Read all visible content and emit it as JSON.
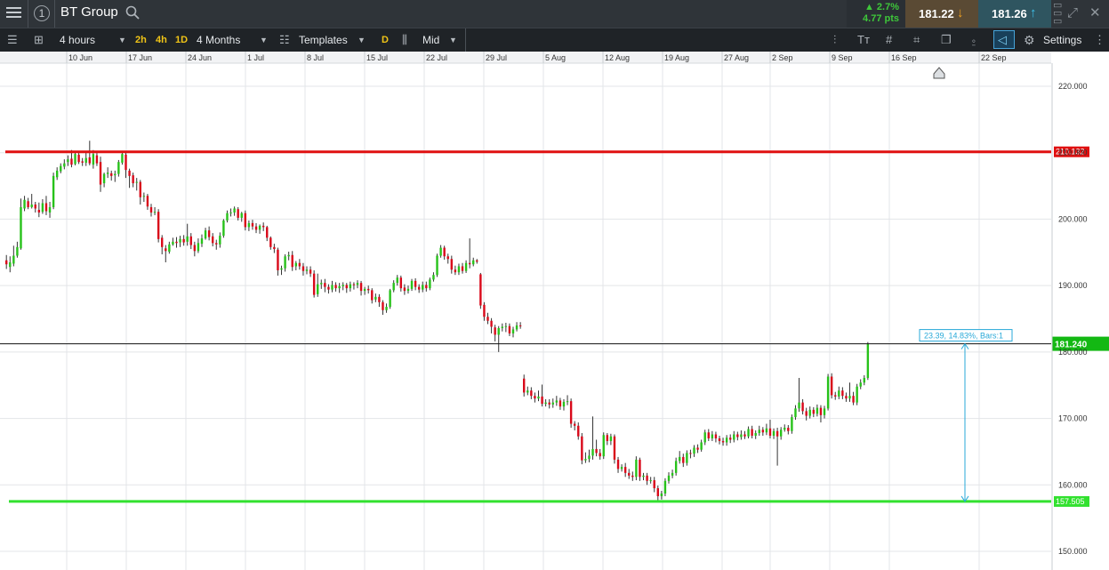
{
  "header": {
    "symbol": "BT Group",
    "change_pct": "▲ 2.7%",
    "change_pts": "4.77 pts",
    "sell_price": "181.22",
    "buy_price": "181.26"
  },
  "toolbar": {
    "interval": "4 hours",
    "quick_intervals": [
      "2h",
      "4h",
      "1D"
    ],
    "range": "4 Months",
    "templates": "Templates",
    "draw_mode": "D",
    "price_type": "Mid",
    "settings": "Settings"
  },
  "colors": {
    "up": "#27c21a",
    "down": "#d9091a",
    "resistance": "#e01010",
    "support": "#32e12f",
    "measure": "#29a9d8",
    "grid": "#e3e5e8"
  },
  "chart_data": {
    "type": "candlestick",
    "x_ticks": [
      "10 Jun",
      "17 Jun",
      "24 Jun",
      "1 Jul",
      "8 Jul",
      "15 Jul",
      "22 Jul",
      "29 Jul",
      "5 Aug",
      "12 Aug",
      "19 Aug",
      "27 Aug",
      "2 Sep",
      "9 Sep",
      "16 Sep",
      "22 Sep"
    ],
    "y_ticks": [
      "220.000",
      "210.000",
      "200.000",
      "190.000",
      "180.000",
      "170.000",
      "160.000",
      "150.000"
    ],
    "y_range": [
      148,
      223
    ],
    "resistance_level": 210.132,
    "resistance_label": "210.132",
    "support_level": 157.505,
    "support_label": "157.505",
    "last_price": 181.24,
    "last_price_label": "181.240",
    "measure_label": "23.39, 14.83%, Bars:1",
    "candles": [
      [
        193.8,
        193.2,
        194.6,
        192.5
      ],
      [
        192.8,
        193.5,
        194.4,
        192.0
      ],
      [
        193.3,
        194.5,
        196.0,
        192.9
      ],
      [
        194.5,
        195.8,
        196.6,
        194.2
      ],
      [
        195.6,
        201.8,
        203.1,
        195.4
      ],
      [
        201.6,
        202.9,
        203.5,
        201.2
      ],
      [
        202.7,
        201.8,
        203.2,
        201.5
      ],
      [
        201.8,
        202.2,
        203.8,
        201.6
      ],
      [
        202.2,
        201.6,
        202.6,
        201.0
      ],
      [
        201.4,
        201.0,
        202.5,
        200.3
      ],
      [
        201.1,
        202.4,
        203.0,
        200.8
      ],
      [
        202.4,
        201.2,
        203.5,
        200.6
      ],
      [
        201.0,
        201.8,
        202.6,
        200.2
      ],
      [
        201.8,
        206.5,
        207.0,
        201.5
      ],
      [
        206.3,
        207.3,
        207.8,
        205.9
      ],
      [
        207.2,
        208.0,
        208.4,
        206.9
      ],
      [
        207.9,
        208.4,
        209.0,
        207.5
      ],
      [
        208.6,
        209.0,
        209.6,
        208.0
      ],
      [
        209.1,
        208.2,
        210.4,
        207.8
      ],
      [
        208.3,
        209.8,
        210.3,
        208.1
      ],
      [
        209.7,
        208.6,
        210.1,
        208.3
      ],
      [
        208.7,
        208.5,
        209.2,
        208.0
      ],
      [
        208.5,
        209.2,
        210.2,
        208.0
      ],
      [
        209.3,
        208.4,
        211.8,
        208.1
      ],
      [
        208.2,
        209.8,
        210.4,
        207.6
      ],
      [
        209.6,
        208.4,
        210.0,
        208.0
      ],
      [
        208.6,
        205.2,
        209.4,
        204.1
      ],
      [
        205.4,
        206.8,
        207.0,
        204.8
      ],
      [
        206.8,
        207.0,
        207.8,
        206.2
      ],
      [
        206.9,
        206.5,
        207.3,
        205.8
      ],
      [
        206.6,
        206.8,
        207.3,
        205.6
      ],
      [
        206.8,
        208.6,
        208.9,
        206.4
      ],
      [
        208.5,
        209.8,
        210.3,
        208.2
      ],
      [
        209.7,
        207.4,
        210.0,
        206.2
      ],
      [
        207.3,
        206.5,
        207.6,
        204.7
      ],
      [
        206.6,
        205.4,
        207.0,
        204.8
      ],
      [
        205.5,
        205.6,
        206.2,
        204.3
      ],
      [
        205.6,
        203.3,
        205.9,
        202.2
      ],
      [
        203.4,
        203.5,
        204.0,
        202.6
      ],
      [
        203.5,
        201.9,
        203.8,
        201.4
      ],
      [
        201.8,
        201.0,
        202.3,
        200.4
      ],
      [
        201.0,
        201.1,
        201.8,
        200.6
      ],
      [
        201.1,
        197.0,
        201.5,
        196.5
      ],
      [
        197.2,
        195.8,
        197.6,
        194.7
      ],
      [
        195.6,
        195.2,
        196.1,
        193.5
      ],
      [
        195.1,
        196.2,
        196.6,
        194.8
      ],
      [
        196.2,
        196.6,
        197.2,
        196.0
      ],
      [
        196.6,
        196.4,
        197.3,
        195.7
      ],
      [
        196.5,
        197.0,
        197.5,
        195.8
      ],
      [
        197.0,
        196.5,
        197.6,
        196.0
      ],
      [
        196.6,
        197.4,
        199.3,
        196.0
      ],
      [
        197.4,
        196.1,
        197.9,
        195.5
      ],
      [
        196.1,
        195.2,
        196.6,
        194.4
      ],
      [
        195.2,
        196.4,
        197.1,
        194.9
      ],
      [
        196.3,
        197.1,
        197.7,
        195.8
      ],
      [
        197.1,
        198.3,
        198.7,
        196.9
      ],
      [
        198.3,
        197.3,
        198.9,
        196.8
      ],
      [
        197.4,
        196.4,
        197.9,
        195.9
      ],
      [
        196.4,
        196.2,
        196.9,
        195.4
      ],
      [
        196.2,
        197.5,
        198.0,
        195.7
      ],
      [
        197.5,
        199.8,
        200.0,
        197.2
      ],
      [
        199.8,
        200.9,
        201.3,
        199.5
      ],
      [
        200.9,
        201.0,
        201.6,
        200.4
      ],
      [
        201.0,
        201.6,
        201.9,
        200.5
      ],
      [
        201.5,
        200.2,
        201.8,
        199.8
      ],
      [
        200.2,
        200.9,
        201.1,
        199.6
      ],
      [
        200.9,
        198.8,
        201.3,
        198.3
      ],
      [
        198.8,
        199.4,
        199.8,
        198.2
      ],
      [
        199.4,
        198.9,
        199.9,
        198.4
      ],
      [
        198.9,
        198.4,
        199.4,
        197.9
      ],
      [
        198.4,
        199.0,
        199.2,
        197.8
      ],
      [
        199.0,
        198.8,
        199.5,
        198.2
      ],
      [
        198.8,
        197.2,
        199.0,
        196.7
      ],
      [
        197.2,
        195.8,
        197.4,
        195.4
      ],
      [
        195.8,
        195.5,
        196.3,
        194.9
      ],
      [
        195.4,
        192.3,
        195.7,
        191.5
      ],
      [
        192.4,
        192.6,
        193.0,
        191.6
      ],
      [
        192.6,
        194.4,
        194.7,
        192.1
      ],
      [
        194.4,
        194.6,
        195.1,
        193.8
      ],
      [
        194.6,
        192.8,
        195.2,
        192.2
      ],
      [
        192.9,
        193.4,
        193.7,
        192.3
      ],
      [
        193.4,
        192.9,
        194.0,
        192.4
      ],
      [
        192.9,
        192.2,
        193.4,
        191.5
      ],
      [
        192.2,
        192.4,
        192.9,
        191.7
      ],
      [
        192.4,
        191.8,
        192.9,
        191.3
      ],
      [
        191.8,
        188.6,
        192.3,
        188.2
      ],
      [
        188.7,
        190.2,
        191.8,
        188.3
      ],
      [
        190.2,
        190.4,
        190.9,
        189.5
      ],
      [
        190.4,
        189.8,
        191.0,
        189.0
      ],
      [
        189.8,
        189.4,
        190.2,
        188.8
      ],
      [
        189.4,
        190.1,
        190.7,
        189.0
      ],
      [
        190.1,
        189.6,
        190.5,
        189.1
      ],
      [
        189.6,
        189.9,
        190.4,
        188.9
      ],
      [
        189.9,
        190.1,
        190.5,
        189.3
      ],
      [
        190.1,
        189.6,
        190.4,
        188.9
      ],
      [
        189.6,
        190.2,
        190.6,
        189.1
      ],
      [
        190.2,
        190.1,
        190.5,
        189.4
      ],
      [
        190.1,
        190.4,
        190.8,
        189.6
      ],
      [
        190.4,
        189.2,
        190.7,
        188.5
      ],
      [
        189.2,
        189.5,
        189.8,
        188.6
      ],
      [
        189.5,
        189.3,
        190.0,
        188.8
      ],
      [
        189.3,
        187.8,
        189.6,
        187.3
      ],
      [
        187.9,
        188.3,
        188.8,
        187.5
      ],
      [
        188.3,
        187.5,
        188.7,
        186.8
      ],
      [
        187.5,
        186.3,
        187.8,
        185.6
      ],
      [
        186.3,
        186.8,
        187.3,
        185.9
      ],
      [
        186.8,
        189.3,
        189.5,
        186.5
      ],
      [
        189.3,
        190.4,
        190.8,
        189.0
      ],
      [
        190.4,
        191.2,
        191.6,
        190.0
      ],
      [
        191.2,
        189.6,
        191.5,
        189.1
      ],
      [
        189.7,
        189.2,
        190.2,
        188.6
      ],
      [
        189.2,
        189.5,
        190.0,
        188.8
      ],
      [
        189.5,
        190.7,
        191.0,
        189.2
      ],
      [
        190.7,
        189.8,
        191.1,
        189.3
      ],
      [
        189.8,
        189.4,
        190.2,
        188.9
      ],
      [
        189.4,
        190.1,
        190.6,
        189.0
      ],
      [
        190.1,
        189.6,
        190.6,
        189.1
      ],
      [
        189.6,
        190.9,
        191.2,
        189.3
      ],
      [
        190.9,
        191.6,
        192.0,
        190.6
      ],
      [
        191.6,
        194.5,
        194.8,
        191.3
      ],
      [
        194.5,
        195.7,
        196.1,
        194.2
      ],
      [
        195.7,
        194.4,
        196.0,
        193.9
      ],
      [
        194.4,
        194.0,
        194.8,
        193.3
      ],
      [
        194.0,
        192.4,
        194.5,
        191.8
      ],
      [
        192.4,
        192.0,
        193.0,
        191.6
      ],
      [
        192.0,
        192.9,
        193.3,
        191.6
      ],
      [
        192.9,
        192.2,
        193.4,
        191.8
      ],
      [
        192.2,
        193.4,
        193.8,
        191.9
      ],
      [
        193.4,
        193.2,
        197.1,
        192.6
      ],
      [
        193.2,
        193.8,
        194.2,
        192.9
      ],
      [
        193.8,
        193.6,
        194.0,
        193.3
      ],
      [
        191.7,
        187.0,
        191.9,
        186.5
      ],
      [
        187.1,
        185.3,
        187.5,
        184.7
      ],
      [
        185.3,
        184.7,
        185.9,
        184.2
      ],
      [
        184.7,
        183.8,
        185.1,
        182.8
      ],
      [
        183.7,
        182.6,
        184.1,
        181.6
      ],
      [
        182.6,
        183.6,
        183.9,
        180.0
      ],
      [
        183.6,
        183.8,
        184.3,
        183.1
      ],
      [
        183.8,
        183.9,
        184.4,
        183.0
      ],
      [
        183.9,
        182.8,
        184.3,
        182.4
      ],
      [
        182.8,
        183.4,
        183.8,
        182.2
      ],
      [
        183.4,
        184.0,
        184.5,
        183.1
      ],
      [
        184.0,
        183.9,
        184.5,
        183.5
      ],
      [
        176.0,
        173.9,
        176.6,
        173.3
      ],
      [
        173.9,
        174.2,
        174.8,
        173.5
      ],
      [
        174.2,
        173.4,
        174.7,
        172.9
      ],
      [
        173.4,
        173.0,
        173.9,
        172.4
      ],
      [
        173.0,
        173.3,
        174.2,
        172.6
      ],
      [
        173.3,
        172.2,
        175.1,
        171.8
      ],
      [
        172.2,
        172.4,
        172.9,
        171.8
      ],
      [
        172.4,
        172.1,
        172.9,
        171.5
      ],
      [
        172.1,
        172.4,
        173.0,
        171.6
      ],
      [
        172.4,
        172.7,
        173.4,
        171.9
      ],
      [
        172.7,
        171.8,
        173.1,
        171.3
      ],
      [
        171.8,
        172.5,
        172.9,
        171.2
      ],
      [
        172.5,
        172.6,
        173.5,
        172.0
      ],
      [
        172.6,
        169.2,
        173.0,
        168.6
      ],
      [
        169.2,
        168.9,
        169.6,
        168.2
      ],
      [
        168.9,
        167.3,
        169.4,
        166.8
      ],
      [
        167.3,
        163.7,
        167.8,
        163.1
      ],
      [
        163.7,
        163.9,
        164.9,
        163.3
      ],
      [
        163.9,
        164.4,
        165.3,
        163.4
      ],
      [
        164.4,
        165.4,
        170.3,
        163.8
      ],
      [
        165.4,
        164.8,
        166.8,
        164.3
      ],
      [
        164.8,
        164.3,
        165.4,
        163.8
      ],
      [
        164.3,
        167.5,
        167.9,
        163.9
      ],
      [
        167.5,
        166.6,
        167.8,
        166.0
      ],
      [
        166.6,
        167.3,
        167.7,
        166.0
      ],
      [
        167.3,
        163.8,
        167.6,
        163.2
      ],
      [
        163.8,
        162.4,
        164.2,
        161.8
      ],
      [
        162.4,
        162.7,
        163.1,
        162.0
      ],
      [
        162.7,
        161.8,
        163.3,
        161.2
      ],
      [
        161.8,
        161.4,
        162.4,
        160.9
      ],
      [
        161.4,
        161.2,
        162.0,
        160.6
      ],
      [
        161.2,
        163.8,
        164.3,
        160.7
      ],
      [
        163.8,
        161.2,
        164.1,
        160.6
      ],
      [
        161.2,
        161.4,
        161.8,
        160.7
      ],
      [
        161.4,
        160.6,
        161.8,
        160.0
      ],
      [
        160.6,
        160.7,
        161.2,
        160.2
      ],
      [
        160.7,
        159.5,
        161.2,
        158.9
      ],
      [
        159.5,
        158.3,
        159.9,
        157.6
      ],
      [
        158.3,
        158.7,
        159.1,
        157.8
      ],
      [
        158.7,
        160.6,
        161.0,
        158.3
      ],
      [
        160.6,
        161.4,
        161.9,
        160.2
      ],
      [
        161.4,
        161.8,
        162.3,
        161.0
      ],
      [
        161.8,
        163.6,
        164.1,
        161.4
      ],
      [
        163.6,
        164.2,
        165.1,
        163.2
      ],
      [
        164.2,
        163.3,
        164.7,
        162.7
      ],
      [
        163.3,
        164.8,
        165.2,
        162.9
      ],
      [
        164.8,
        164.7,
        165.3,
        164.0
      ],
      [
        164.7,
        165.6,
        166.0,
        164.2
      ],
      [
        165.6,
        165.3,
        166.1,
        164.8
      ],
      [
        165.3,
        166.4,
        166.8,
        165.0
      ],
      [
        166.4,
        167.9,
        168.3,
        166.0
      ],
      [
        167.9,
        167.0,
        168.4,
        166.6
      ],
      [
        167.0,
        167.6,
        168.1,
        166.6
      ],
      [
        167.6,
        167.0,
        168.0,
        166.4
      ],
      [
        167.0,
        166.6,
        167.4,
        166.1
      ],
      [
        166.6,
        166.4,
        167.1,
        165.9
      ],
      [
        166.4,
        167.1,
        167.5,
        165.9
      ],
      [
        167.1,
        166.8,
        167.6,
        166.3
      ],
      [
        166.8,
        167.6,
        168.1,
        166.4
      ],
      [
        167.6,
        167.2,
        168.0,
        166.7
      ],
      [
        167.2,
        167.6,
        168.2,
        166.8
      ],
      [
        167.6,
        167.3,
        168.1,
        166.9
      ],
      [
        167.3,
        168.4,
        168.8,
        167.0
      ],
      [
        168.4,
        167.4,
        168.9,
        167.0
      ],
      [
        167.4,
        167.8,
        168.2,
        166.9
      ],
      [
        167.8,
        168.3,
        168.9,
        167.4
      ],
      [
        168.3,
        167.9,
        168.7,
        167.4
      ],
      [
        167.9,
        168.5,
        169.2,
        167.5
      ],
      [
        168.5,
        167.4,
        169.8,
        167.0
      ],
      [
        167.4,
        168.1,
        168.5,
        166.9
      ],
      [
        168.1,
        167.3,
        168.6,
        162.9
      ],
      [
        167.3,
        168.3,
        168.7,
        166.8
      ],
      [
        168.3,
        168.6,
        169.1,
        168.0
      ],
      [
        168.6,
        168.1,
        169.0,
        167.6
      ],
      [
        168.1,
        170.2,
        170.6,
        167.7
      ],
      [
        170.2,
        171.5,
        172.0,
        169.8
      ],
      [
        171.5,
        172.4,
        176.1,
        171.0
      ],
      [
        172.4,
        171.1,
        172.9,
        170.6
      ],
      [
        171.1,
        170.4,
        171.6,
        169.7
      ],
      [
        170.4,
        171.3,
        171.8,
        170.0
      ],
      [
        171.3,
        170.7,
        171.7,
        170.2
      ],
      [
        170.7,
        171.6,
        172.1,
        170.3
      ],
      [
        171.6,
        170.5,
        172.0,
        169.4
      ],
      [
        170.5,
        171.5,
        171.9,
        170.0
      ],
      [
        171.5,
        176.3,
        176.7,
        171.2
      ],
      [
        176.3,
        173.5,
        176.8,
        173.0
      ],
      [
        173.5,
        173.3,
        174.0,
        172.8
      ],
      [
        173.3,
        174.2,
        174.8,
        172.9
      ],
      [
        174.2,
        173.4,
        174.7,
        172.9
      ],
      [
        173.4,
        173.0,
        173.9,
        172.5
      ],
      [
        173.0,
        173.4,
        175.4,
        172.5
      ],
      [
        173.4,
        172.4,
        174.0,
        172.0
      ],
      [
        172.4,
        174.8,
        175.2,
        172.0
      ],
      [
        174.8,
        175.4,
        175.9,
        174.4
      ],
      [
        175.4,
        176.1,
        176.5,
        175.0
      ],
      [
        176.1,
        181.2,
        181.5,
        175.8
      ]
    ]
  }
}
